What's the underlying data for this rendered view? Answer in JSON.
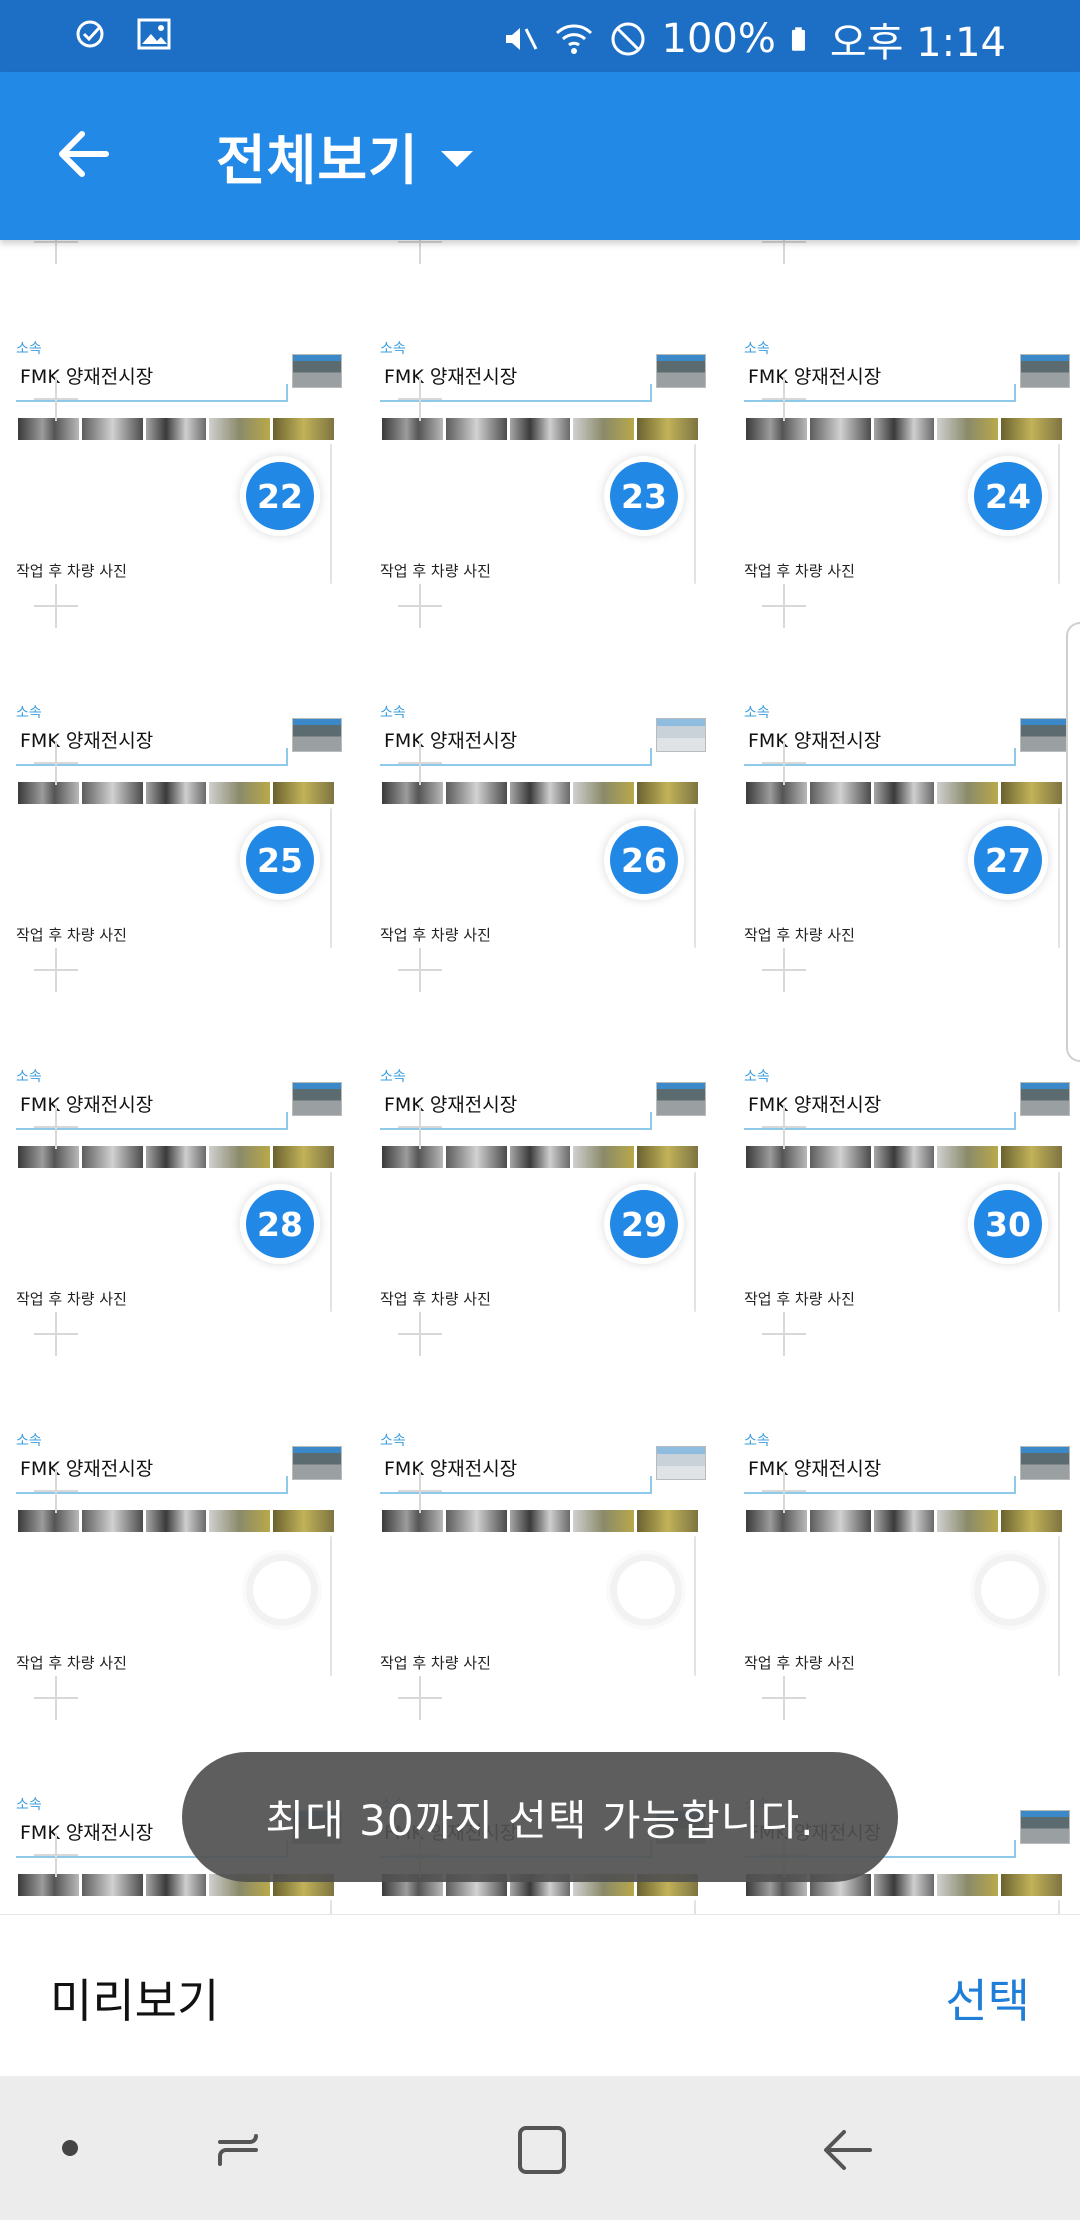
{
  "status": {
    "battery": "100%",
    "time": "오후 1:14"
  },
  "appbar": {
    "title": "전체보기"
  },
  "grid": {
    "sosok_label": "소속",
    "place_text": "FMK 양재전시장",
    "work_label": "작업 후 차량 사진",
    "rows": [
      [
        "22",
        "23",
        "24"
      ],
      [
        "25",
        "26",
        "27"
      ],
      [
        "28",
        "29",
        "30"
      ],
      [
        "",
        "",
        ""
      ],
      [
        "",
        "",
        ""
      ]
    ]
  },
  "toast": {
    "text": "최대 30까지 선택 가능합니다."
  },
  "bottombar": {
    "preview_label": "미리보기",
    "select_label": "선택"
  },
  "icons": {
    "back": "arrow-left-icon",
    "dropdown": "caret-down-icon",
    "nav": [
      "dot-icon",
      "recent-apps-icon",
      "home-icon",
      "back-nav-icon"
    ]
  },
  "colors": {
    "statusbar": "#1d6fc6",
    "appbar": "#2289e7",
    "badge": "#2288e6",
    "accent_text": "#1f7fd8"
  }
}
